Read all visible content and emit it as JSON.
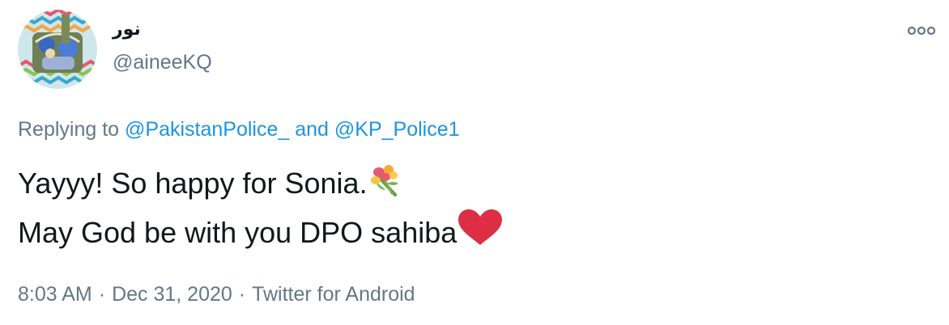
{
  "user": {
    "display_name": "نور",
    "handle": "@aineeKQ",
    "avatar_icon": "user-avatar-icon"
  },
  "more_icon": "more-options-icon",
  "reply": {
    "prefix": "Replying to",
    "mention1": "@PakistanPolice_",
    "conjunction": "and",
    "mention2": "@KP_Police1"
  },
  "tweet": {
    "line1": "Yayyy! So happy for Sonia.",
    "line1_emoji": "bouquet-icon",
    "line2": "May God be with you DPO sahiba",
    "line2_emoji": "red-heart-icon"
  },
  "meta": {
    "time": "8:03 AM",
    "separator": "·",
    "date": "Dec 31, 2020",
    "source": "Twitter for Android"
  },
  "colors": {
    "text": "#14171a",
    "secondary": "#657786",
    "link": "#1b95e0",
    "heart": "#dd2e44"
  }
}
